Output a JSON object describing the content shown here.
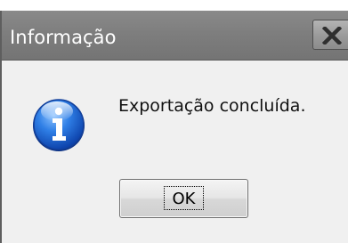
{
  "dialog": {
    "title": "Informação",
    "message": "Exportação concluída.",
    "icon": "info-icon",
    "close_icon": "close-icon",
    "ok_label": "OK"
  }
}
